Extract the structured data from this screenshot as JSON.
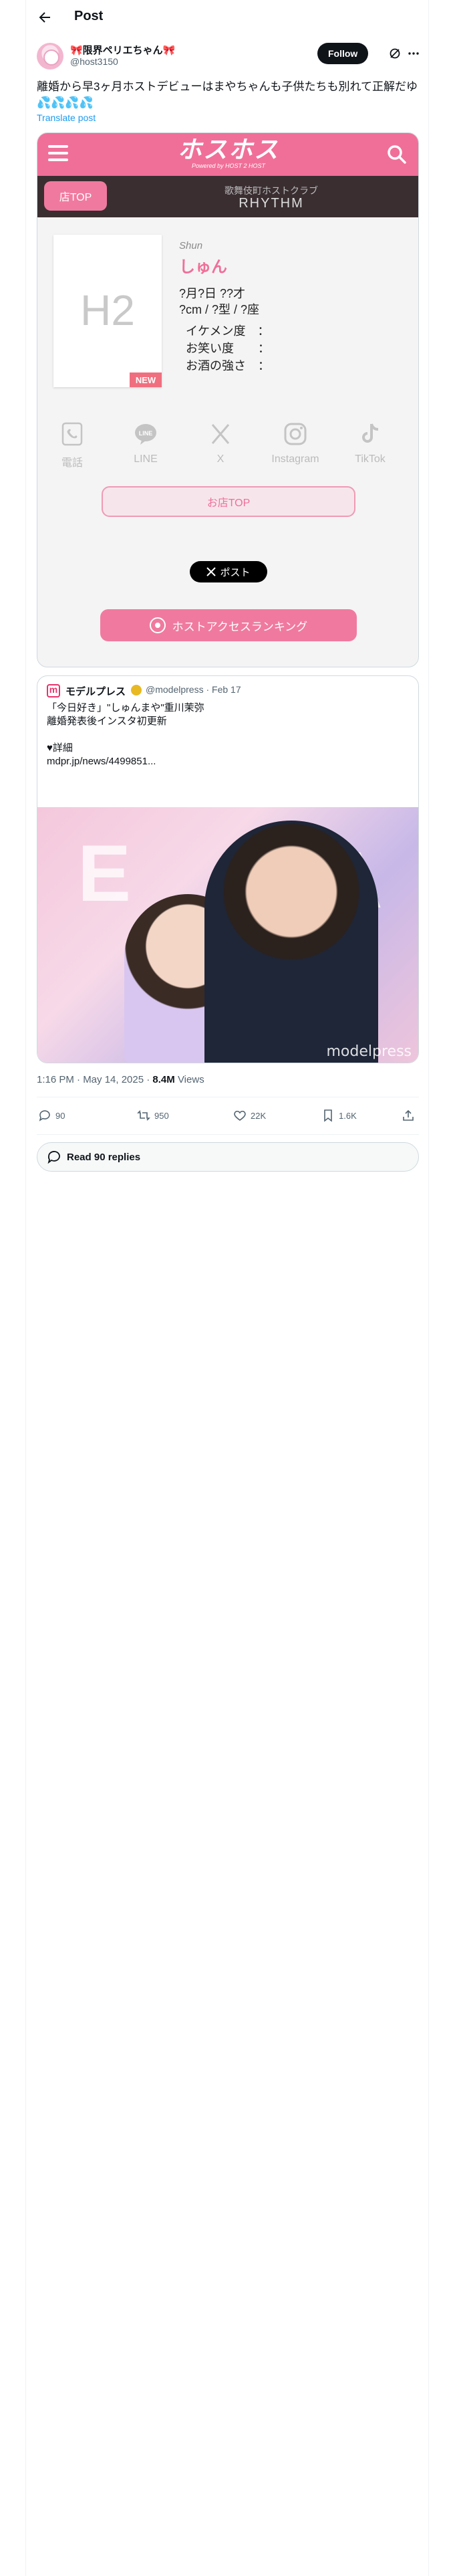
{
  "header": {
    "title": "Post"
  },
  "author": {
    "name": "🎀限界ペリエちゃん🎀",
    "handle": "@host3150",
    "follow_label": "Follow"
  },
  "post": {
    "text": "離婚から早3ヶ月ホストデビューはまやちゃんも子供たちも別れて正解だゆ💦💦💦💦",
    "translate_label": "Translate post"
  },
  "site": {
    "logo": "ホスホス",
    "logo_sub": "Powered by HOST 2 HOST",
    "shop_top_label": "店TOP",
    "club_area": "歌舞伎町ホストクラブ",
    "club_name": "RHYTHM",
    "profile": {
      "image_text": "H2",
      "new_badge": "NEW",
      "name_en": "Shun",
      "name_jp": "しゅん",
      "birthday_age": "?月?日 ??才",
      "height_blood_sign": "?cm / ?型 / ?座",
      "stats": [
        "イケメン度　：",
        "お笑い度　　：",
        "お酒の強さ　："
      ]
    },
    "social": [
      {
        "label": "電話",
        "icon": "phone-icon"
      },
      {
        "label": "LINE",
        "icon": "line-icon"
      },
      {
        "label": "X",
        "icon": "x-icon"
      },
      {
        "label": "Instagram",
        "icon": "instagram-icon"
      },
      {
        "label": "TikTok",
        "icon": "tiktok-icon"
      }
    ],
    "shop_top_link": "お店TOP",
    "x_post_label": "ポスト",
    "ranking_label": "ホストアクセスランキング"
  },
  "quote": {
    "name": "モデルプレス",
    "handle": "@modelpress · Feb 17",
    "lines": [
      "「今日好き」\"しゅんまや\"重川茉弥",
      "離婚発表後インスタ初更新",
      "",
      "♥詳細",
      "mdpr.jp/news/4499851..."
    ],
    "watermark": "modelpress"
  },
  "meta": {
    "time": "1:16 PM · May 14, 2025 · ",
    "views_count": "8.4M",
    "views_label": " Views"
  },
  "actions": {
    "replies": "90",
    "reposts": "950",
    "likes": "22K",
    "bookmarks": "1.6K"
  },
  "read_replies": "Read 90 replies"
}
